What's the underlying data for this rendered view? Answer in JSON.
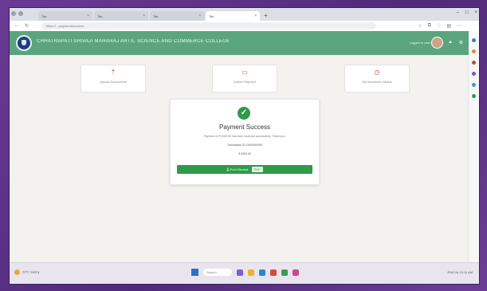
{
  "browser": {
    "tabs": [
      {
        "label": "Tab",
        "active": false
      },
      {
        "label": "Tab",
        "active": false
      },
      {
        "label": "Tab",
        "active": false
      },
      {
        "label": "Tab",
        "active": true
      }
    ],
    "url": "https://.../payment/success"
  },
  "header": {
    "title": "CHHATRAPATI SHIVAJI MAHARAJ ARTS, SCIENCE AND COMMERCE COLLEGE",
    "user": "Logged in user",
    "accent_color": "#5aa57e"
  },
  "quick_actions": [
    {
      "label": "Upload Documents",
      "icon": "upload-icon"
    },
    {
      "label": "Online Payment",
      "icon": "wallet-icon"
    },
    {
      "label": "My Admission Status",
      "icon": "clock-icon"
    }
  ],
  "payment": {
    "title": "Payment Success",
    "message": "Payment of ₹ 0000.00 has been received successfully. Thank you.",
    "reference": "Transaction ID: 0000000000",
    "amount": "₹ 0000.00",
    "button_label": "Print Receipt",
    "button_chip": "PDF",
    "success_color": "#2f9a48"
  },
  "taskbar": {
    "weather": "29°C Sunny",
    "search_placeholder": "Search",
    "tray": "ENG IN 10:11 AM"
  }
}
